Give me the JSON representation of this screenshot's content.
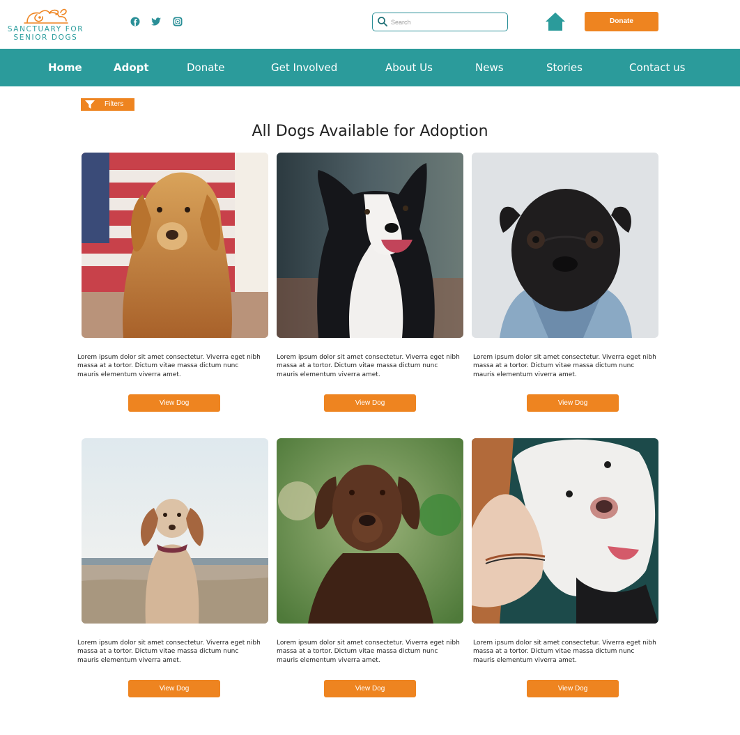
{
  "brand": {
    "name_line1": "SANCTUARY FOR",
    "name_line2": "SENIOR DOGS",
    "primary_color": "#2b9b9b",
    "accent_color": "#ee8420"
  },
  "header": {
    "social_icons": [
      "facebook-icon",
      "twitter-icon",
      "instagram-icon"
    ],
    "search_placeholder": "Search",
    "home_icon": "home-icon",
    "donate_label": "Donate"
  },
  "nav": {
    "items": [
      {
        "label": "Home"
      },
      {
        "label": "Adopt"
      },
      {
        "label": "Donate"
      },
      {
        "label": "Get Involved"
      },
      {
        "label": "About Us"
      },
      {
        "label": "News"
      },
      {
        "label": "Stories"
      },
      {
        "label": "Contact us"
      }
    ]
  },
  "filters": {
    "label": "Filters",
    "icon": "filter-icon"
  },
  "main": {
    "title": "All Dogs Available for Adoption",
    "dogs": [
      {
        "description": "Lorem ipsum dolor sit amet consectetur. Viverra eget nibh massa at a tortor. Dictum vitae massa dictum nunc mauris elementum viverra amet.",
        "button_label": "View Dog"
      },
      {
        "description": "Lorem ipsum dolor sit amet consectetur. Viverra eget nibh massa at a tortor. Dictum vitae massa dictum nunc mauris elementum viverra amet.",
        "button_label": "View Dog"
      },
      {
        "description": "Lorem ipsum dolor sit amet consectetur. Viverra eget nibh massa at a tortor. Dictum vitae massa dictum nunc mauris elementum viverra amet.",
        "button_label": "View Dog"
      },
      {
        "description": "Lorem ipsum dolor sit amet consectetur. Viverra eget nibh massa at a tortor. Dictum vitae massa dictum nunc mauris elementum viverra amet.",
        "button_label": "View Dog"
      },
      {
        "description": "Lorem ipsum dolor sit amet consectetur. Viverra eget nibh massa at a tortor. Dictum vitae massa dictum nunc mauris elementum viverra amet.",
        "button_label": "View Dog"
      },
      {
        "description": "Lorem ipsum dolor sit amet consectetur. Viverra eget nibh massa at a tortor. Dictum vitae massa dictum nunc mauris elementum viverra amet.",
        "button_label": "View Dog"
      }
    ]
  }
}
